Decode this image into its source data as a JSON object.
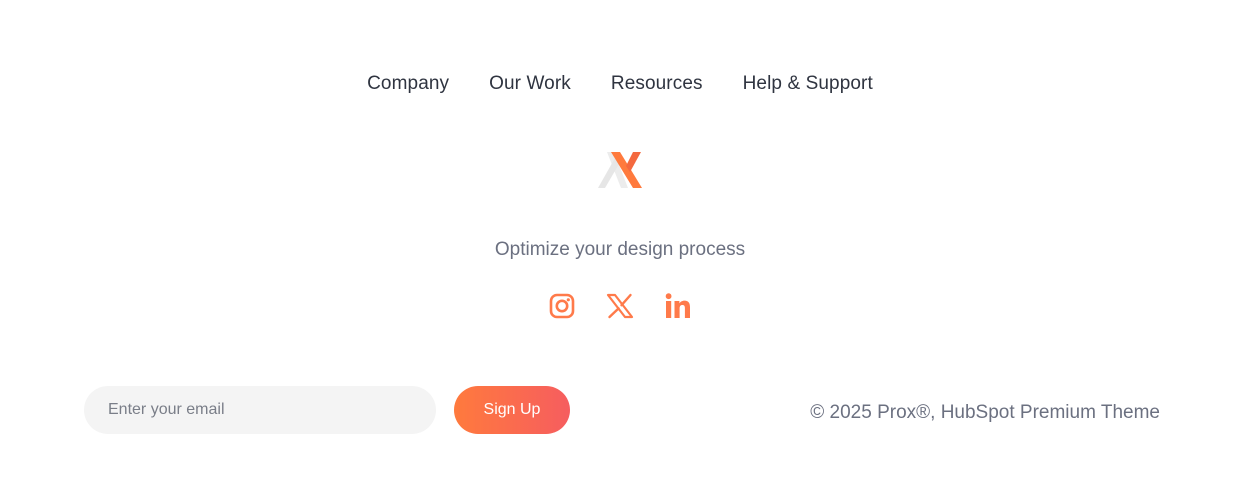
{
  "nav": {
    "items": [
      {
        "label": "Company"
      },
      {
        "label": "Our Work"
      },
      {
        "label": "Resources"
      },
      {
        "label": "Help & Support"
      }
    ]
  },
  "brand": {
    "logo_icon": "prox-x-logo-icon",
    "accent_color": "#ff7a3d",
    "accent_color_end": "#f65d5f"
  },
  "tagline": "Optimize your design process",
  "social": {
    "icons": [
      "instagram-icon",
      "x-twitter-icon",
      "linkedin-icon"
    ],
    "color": "#ff7a4a"
  },
  "newsletter": {
    "email_placeholder": "Enter your email",
    "signup_label": "Sign Up"
  },
  "copyright": "© 2025 Prox®, HubSpot Premium Theme"
}
